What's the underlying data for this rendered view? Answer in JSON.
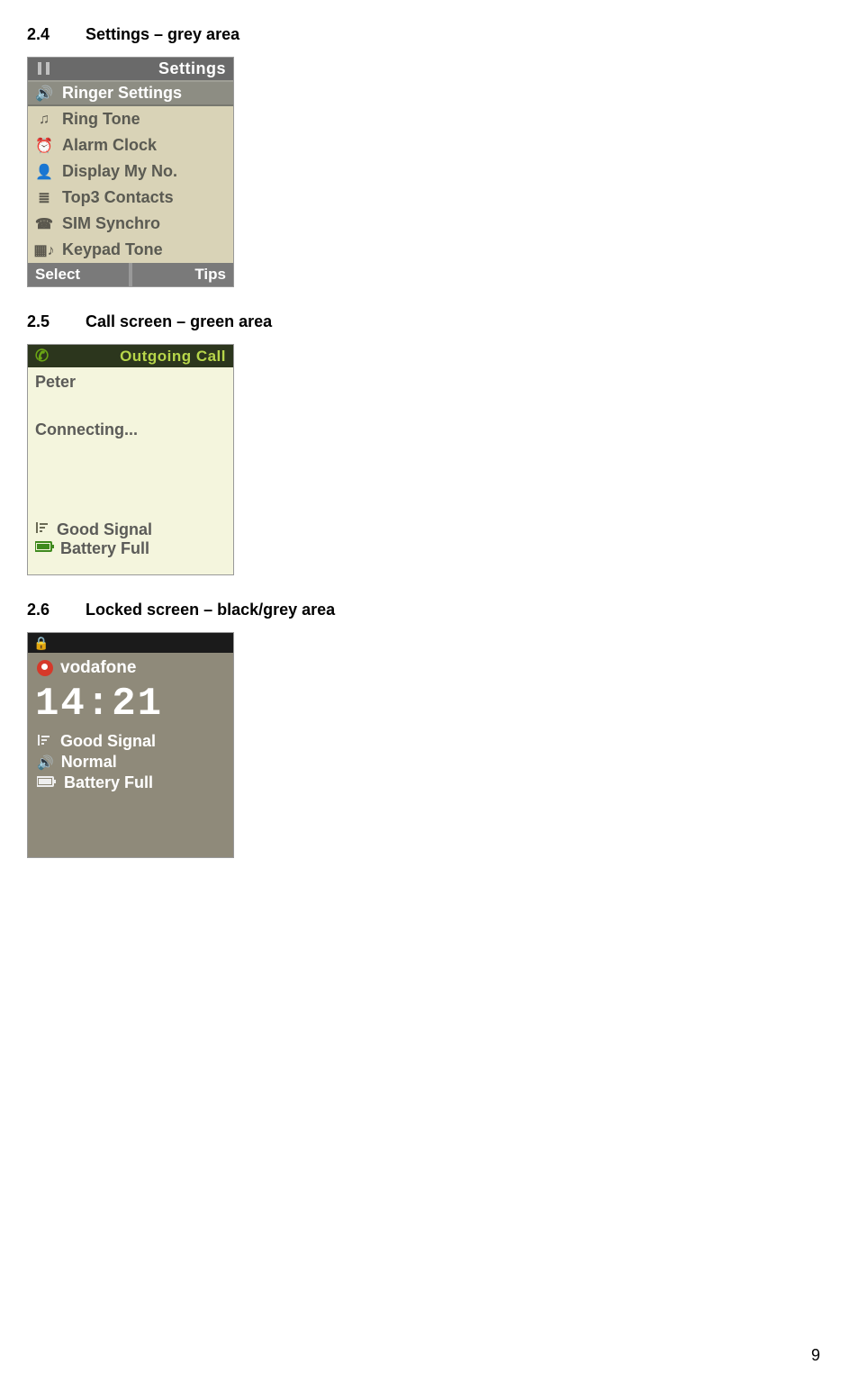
{
  "sections": {
    "s24": {
      "num": "2.4",
      "title": "Settings – grey area"
    },
    "s25": {
      "num": "2.5",
      "title": "Call screen – green area"
    },
    "s26": {
      "num": "2.6",
      "title": "Locked screen – black/grey area"
    }
  },
  "settings": {
    "header": "Settings",
    "items": [
      {
        "icon": "speaker-icon",
        "glyph": "🔊",
        "label": "Ringer Settings",
        "selected": true
      },
      {
        "icon": "music-icon",
        "glyph": "♫",
        "label": "Ring Tone"
      },
      {
        "icon": "alarm-icon",
        "glyph": "⏰",
        "label": "Alarm Clock"
      },
      {
        "icon": "contact-icon",
        "glyph": "👤",
        "label": "Display My No."
      },
      {
        "icon": "contacts-icon",
        "glyph": "≣",
        "label": "Top3 Contacts"
      },
      {
        "icon": "sim-icon",
        "glyph": "☎",
        "label": "SIM Synchro"
      },
      {
        "icon": "keypad-icon",
        "glyph": "▦♪",
        "label": "Keypad Tone"
      }
    ],
    "softkeys": {
      "left": "Select",
      "right": "Tips"
    }
  },
  "call": {
    "header": "Outgoing Call",
    "name": "Peter",
    "status": "Connecting...",
    "signal": "Good Signal",
    "battery": "Battery Full"
  },
  "locked": {
    "operator": "vodafone",
    "time": "14:21",
    "signal": "Good Signal",
    "ringer": "Normal",
    "battery": "Battery Full"
  },
  "page_number": "9"
}
